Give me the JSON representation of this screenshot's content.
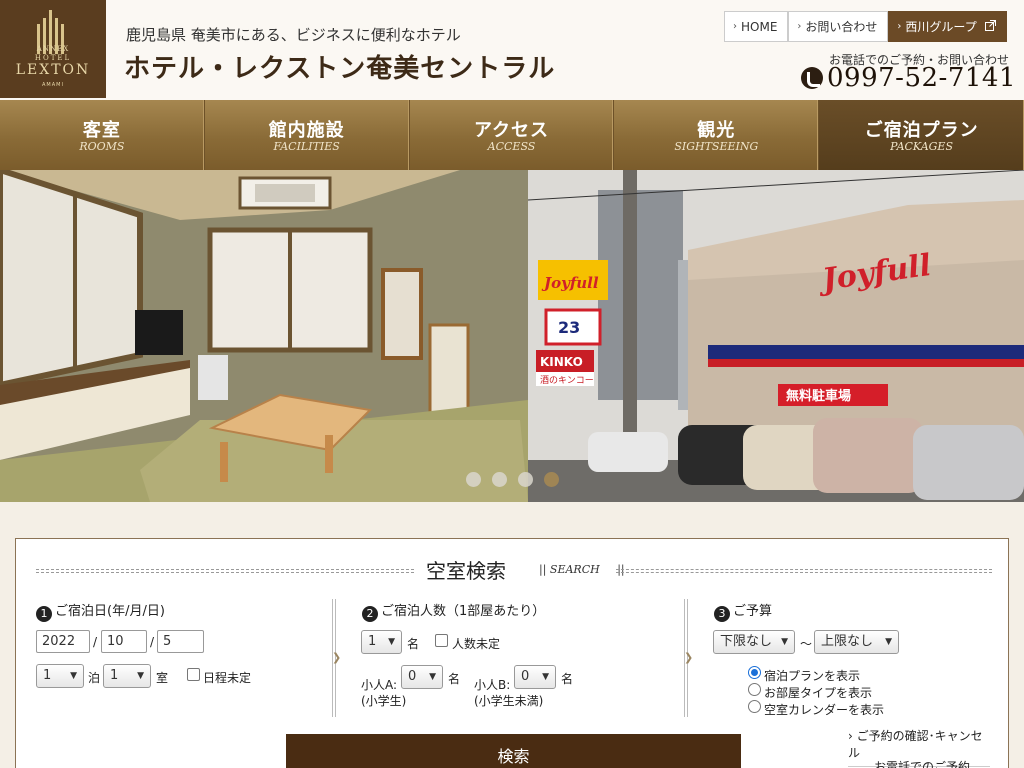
{
  "header": {
    "logo": {
      "annex": "ANNEX",
      "hotel": "HOTEL",
      "name": "LEXTON",
      "sub": "AMAMI"
    },
    "tagline": "鹿児島県 奄美市にある、ビジネスに便利なホテル",
    "title": "ホテル・レクストン奄美セントラル",
    "top_links": [
      {
        "label": "HOME",
        "icon": "chevron-right-icon"
      },
      {
        "label": "お問い合わせ",
        "icon": "chevron-right-icon"
      },
      {
        "label": "西川グループ",
        "icon": "external-link-icon"
      }
    ],
    "phone_caption": "お電話でのご予約・お問い合わせ",
    "phone_number": "0997-52-7141",
    "phone_icon": "phone-icon"
  },
  "nav": [
    {
      "jp": "客室",
      "en": "ROOMS"
    },
    {
      "jp": "館内施設",
      "en": "FACILITIES"
    },
    {
      "jp": "アクセス",
      "en": "ACCESS"
    },
    {
      "jp": "観光",
      "en": "SIGHTSEEING"
    },
    {
      "jp": "ご宿泊プラン",
      "en": "PACKAGES"
    }
  ],
  "hero": {
    "signs": {
      "joyfull_small": "Joyfull",
      "joyfull_big": "Joyfull",
      "store_23": "23",
      "kinko": "KINKO",
      "kinko_sub": "酒のキンコー",
      "lot": "無料駐車場"
    },
    "slides_total": 4,
    "active_slide": 4
  },
  "search": {
    "title": "空室検索",
    "title_en": "SEARCH",
    "section1": {
      "num": "1",
      "label": "ご宿泊日(年/月/日)",
      "year": "2022",
      "month": "10",
      "day": "5",
      "sep": "/",
      "nights": "1",
      "nights_unit": "泊",
      "rooms": "1",
      "rooms_unit": "室",
      "undecided": "日程未定"
    },
    "section2": {
      "num": "2",
      "label": "ご宿泊人数（1部屋あたり）",
      "adults": "1",
      "unit": "名",
      "undecided": "人数未定",
      "childA_label": "小人A:",
      "childA_note": "(小学生)",
      "childA": "0",
      "childB_label": "小人B:",
      "childB_note": "(小学生未満)",
      "childB": "0"
    },
    "section3": {
      "num": "3",
      "label": "ご予算",
      "min": "下限なし",
      "tilde": "〜",
      "max": "上限なし",
      "options": [
        "宿泊プランを表示",
        "お部屋タイプを表示",
        "空室カレンダーを表示"
      ],
      "selected_index": 0
    },
    "button": "検索",
    "link_confirm": "ご予約の確認･キャンセル",
    "link_phone": "お電話でのご予約"
  }
}
